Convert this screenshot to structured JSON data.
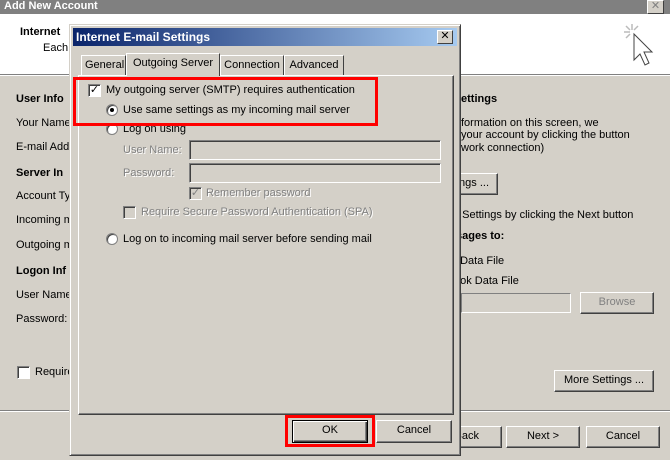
{
  "background_window": {
    "title": "Add New Account",
    "header_title": "Internet",
    "header_subtitle": "Each",
    "left_labels": {
      "user_info_heading": "User Info",
      "your_name": "Your Name",
      "email_address": "E-mail Add",
      "server_info_heading": "Server In",
      "account_type": "Account Ty",
      "incoming": "Incoming m",
      "outgoing": "Outgoing m",
      "logon_info_heading": "Logon Inf",
      "user_name": "User Name",
      "password": "Password:",
      "require": "Require"
    },
    "right_texts": {
      "settings_heading": "ettings",
      "line1": "formation on this screen, we",
      "line2": "your account by clicking the button",
      "line3": "work connection)",
      "test_button": "ings ...",
      "next_hint": "t Settings by clicking the Next button",
      "deliver_heading": "sages to:",
      "data_file_1": "t Data File",
      "data_file_2": "ook Data File",
      "browse_button": "Browse",
      "more_settings_button": "More Settings ..."
    },
    "footer": {
      "back_button": "Back",
      "next_button": "Next >",
      "cancel_button": "Cancel"
    }
  },
  "dialog": {
    "title": "Internet E-mail Settings",
    "tabs": [
      {
        "label": "General"
      },
      {
        "label": "Outgoing Server"
      },
      {
        "label": "Connection"
      },
      {
        "label": "Advanced"
      }
    ],
    "smtp_auth_label": "My outgoing server (SMTP) requires authentication",
    "smtp_auth_checked": true,
    "options": {
      "use_same": "Use same settings as my incoming mail server",
      "log_on_using": "Log on using",
      "user_name_label": "User Name:",
      "password_label": "Password:",
      "remember_password": "Remember password",
      "require_spa": "Require Secure Password Authentication (SPA)",
      "log_on_incoming": "Log on to incoming mail server before sending mail"
    },
    "ok_button": "OK",
    "cancel_button": "Cancel"
  },
  "check_glyph": "✓",
  "close_glyph": "✕",
  "colors": {
    "highlight": "#ff0000",
    "title_bar_active": "#0a246a"
  }
}
